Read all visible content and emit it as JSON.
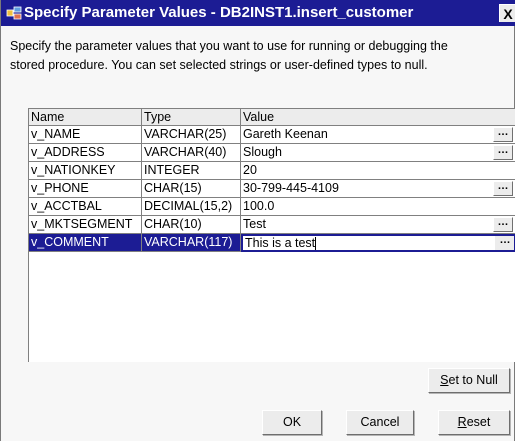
{
  "window": {
    "title": "Specify Parameter Values - DB2INST1.insert_customer",
    "close_label": "X"
  },
  "description": {
    "line1": "Specify the parameter values that you want to use for running or debugging the",
    "line2": "stored procedure.  You can set selected strings or user-defined types to null."
  },
  "table": {
    "headers": {
      "name": "Name",
      "type": "Type",
      "value": "Value"
    },
    "rows": [
      {
        "name": "v_NAME",
        "type": "VARCHAR(25)",
        "value": "Gareth Keenan",
        "has_button": true
      },
      {
        "name": "v_ADDRESS",
        "type": "VARCHAR(40)",
        "value": "Slough",
        "has_button": true
      },
      {
        "name": "v_NATIONKEY",
        "type": "INTEGER",
        "value": "20",
        "has_button": false
      },
      {
        "name": "v_PHONE",
        "type": "CHAR(15)",
        "value": "30-799-445-4109",
        "has_button": true
      },
      {
        "name": "v_ACCTBAL",
        "type": "DECIMAL(15,2)",
        "value": "100.0",
        "has_button": false
      },
      {
        "name": "v_MKTSEGMENT",
        "type": "CHAR(10)",
        "value": "Test",
        "has_button": true
      },
      {
        "name": "v_COMMENT",
        "type": "VARCHAR(117)",
        "value": "This is a test",
        "has_button": true,
        "selected": true
      }
    ],
    "ellipsis_label": "…"
  },
  "buttons": {
    "set_to_null": {
      "mnemonic": "S",
      "rest": "et to Null"
    },
    "ok": "OK",
    "cancel": "Cancel",
    "reset": {
      "mnemonic": "R",
      "rest": "eset"
    }
  },
  "colors": {
    "title_bar": "#1c1c94",
    "selection": "#1c1c94",
    "dialog_background": "#f7f7f7"
  },
  "icons": {
    "title": "database-procedure-icon"
  }
}
